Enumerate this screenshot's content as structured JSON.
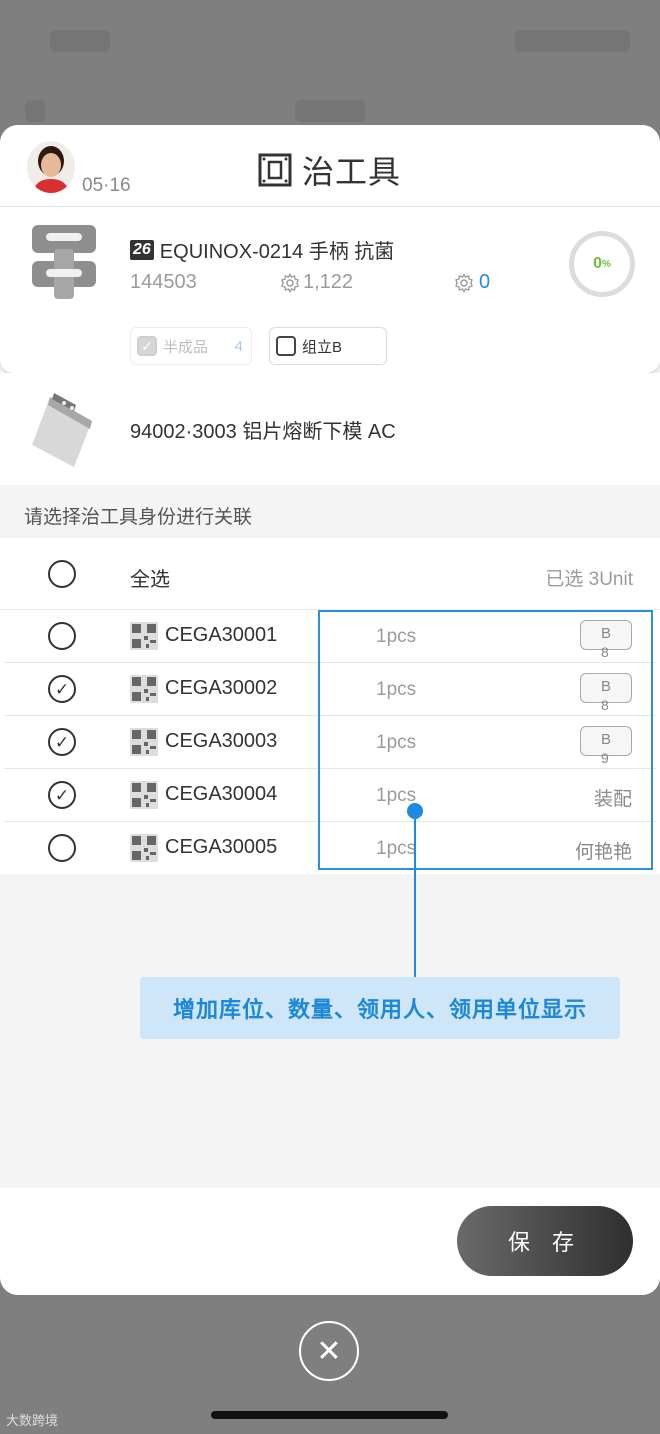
{
  "header": {
    "date": "05·16",
    "title": "治工具"
  },
  "product": {
    "badge": "26",
    "name": "EQUINOX-0214 手柄 抗菌",
    "code": "144503",
    "stat_count": "1,122",
    "stat_zero": "0",
    "progress_value": "0",
    "progress_unit": "%",
    "chip_semi_label": "半成品",
    "chip_semi_count": "4",
    "chip_group_label": "组立B"
  },
  "tool": {
    "name": "94002·3003 铝片熔断下模 AC"
  },
  "prompt": "请选择治工具身份进行关联",
  "list": {
    "select_all_label": "全选",
    "selected_text": "已选 3Unit",
    "rows": [
      {
        "code": "CEGA30001",
        "qty": "1pcs",
        "loc": "B",
        "loc_sub": "8",
        "person": "",
        "checked": false
      },
      {
        "code": "CEGA30002",
        "qty": "1pcs",
        "loc": "B",
        "loc_sub": "8",
        "person": "",
        "checked": true
      },
      {
        "code": "CEGA30003",
        "qty": "1pcs",
        "loc": "B",
        "loc_sub": "9",
        "person": "",
        "checked": true
      },
      {
        "code": "CEGA30004",
        "qty": "1pcs",
        "loc": "",
        "loc_sub": "",
        "person": "装配",
        "checked": true
      },
      {
        "code": "CEGA30005",
        "qty": "1pcs",
        "loc": "",
        "loc_sub": "",
        "person": "何艳艳",
        "checked": false
      }
    ]
  },
  "annotation": "增加库位、数量、领用人、领用单位显示",
  "footer": {
    "save_label": "保 存"
  },
  "close_icon": "close-icon",
  "watermark": "大数跨境",
  "colors": {
    "accent": "#1d88d8",
    "progress": "#6fbf3a",
    "annotation_bg": "#cfe6f8"
  }
}
